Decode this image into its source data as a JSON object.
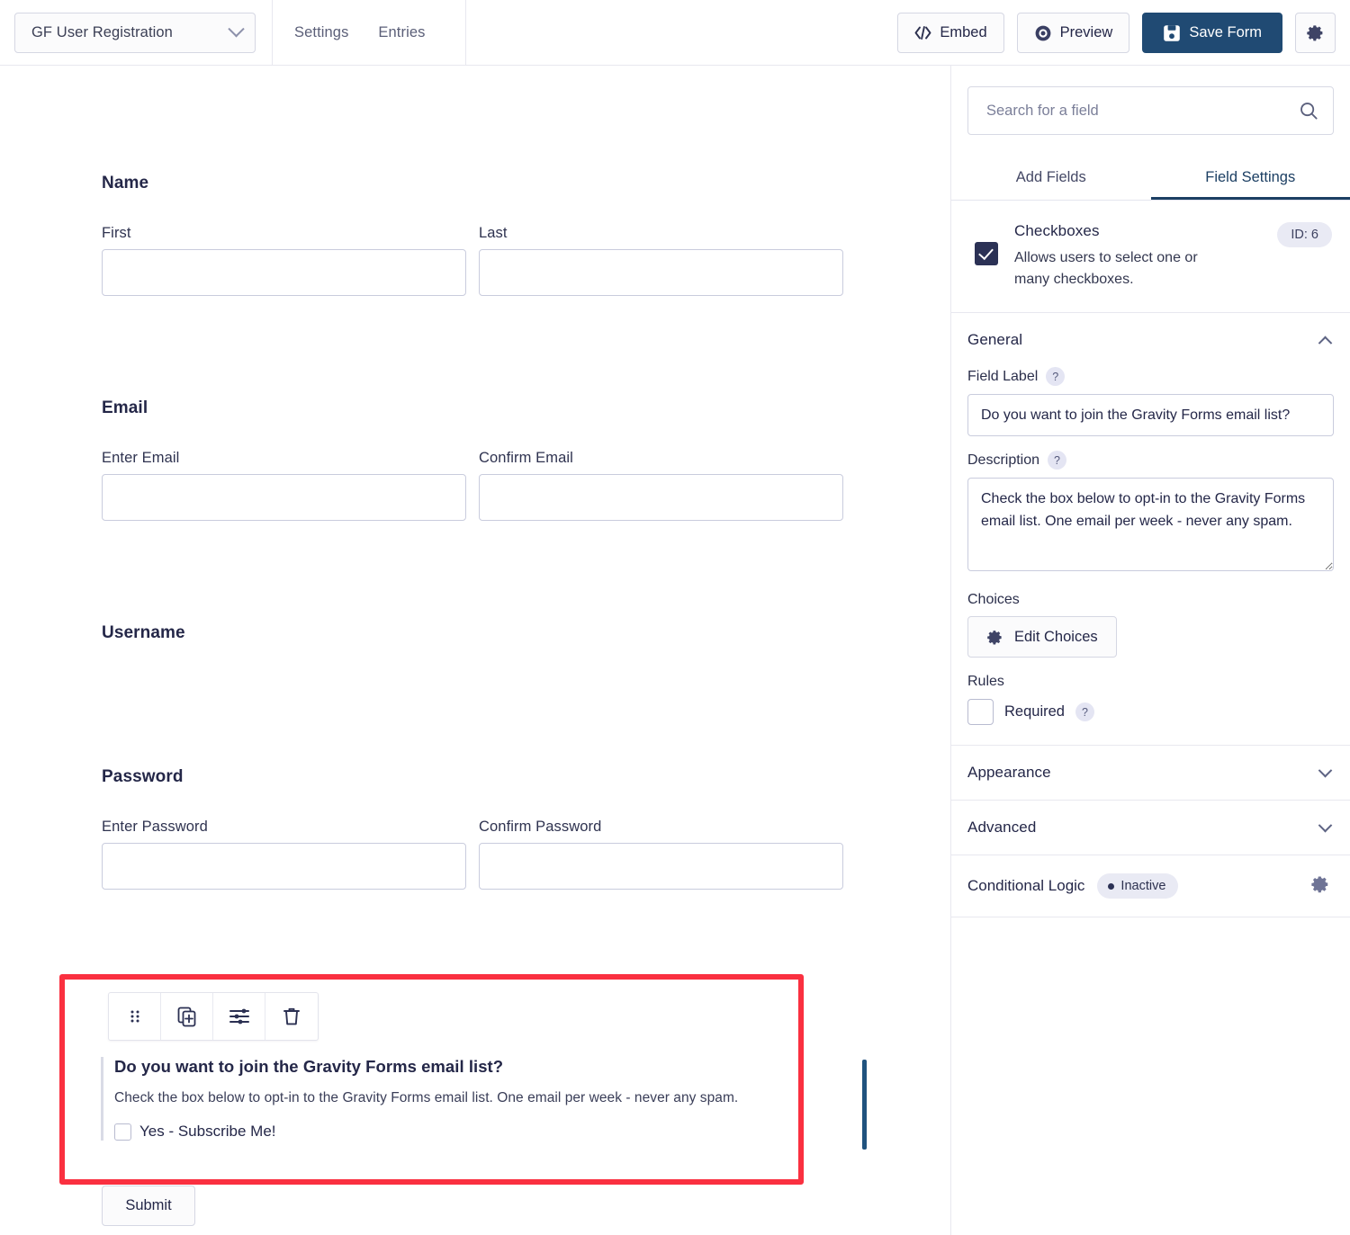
{
  "topbar": {
    "form_name": "GF User Registration",
    "nav_tabs": [
      {
        "label": "Settings"
      },
      {
        "label": "Entries"
      }
    ],
    "actions": {
      "embed_label": "Embed",
      "preview_label": "Preview",
      "save_label": "Save Form",
      "settings_icon": "gear-icon"
    }
  },
  "form": {
    "fields": [
      {
        "title": "Name",
        "inputs": [
          {
            "label": "First",
            "value": ""
          },
          {
            "label": "Last",
            "value": ""
          }
        ]
      },
      {
        "title": "Email",
        "inputs": [
          {
            "label": "Enter Email",
            "value": ""
          },
          {
            "label": "Confirm Email",
            "value": ""
          }
        ]
      },
      {
        "title": "Username",
        "inputs": []
      },
      {
        "title": "Password",
        "inputs": [
          {
            "label": "Enter Password",
            "value": ""
          },
          {
            "label": "Confirm Password",
            "value": ""
          }
        ]
      }
    ],
    "selected_field": {
      "label": "Do you want to join the Gravity Forms email list?",
      "description": "Check the box below to opt-in to the Gravity Forms email list. One email per week - never any spam.",
      "choices": [
        {
          "label": "Yes - Subscribe Me!",
          "checked": false
        }
      ],
      "toolbar_icons": [
        "drag-handle-icon",
        "duplicate-field-icon",
        "field-settings-icon",
        "delete-field-icon"
      ],
      "highlight_color": "#fa3040"
    },
    "submit_label": "Submit"
  },
  "sidebar": {
    "search": {
      "placeholder": "Search for a field",
      "value": "",
      "icon": "search-icon"
    },
    "tabs": [
      {
        "label": "Add Fields",
        "active": false
      },
      {
        "label": "Field Settings",
        "active": true
      }
    ],
    "field_header": {
      "title": "Checkboxes",
      "description": "Allows users to select one or many checkboxes.",
      "id_badge": "ID: 6",
      "checked": true
    },
    "general": {
      "title": "General",
      "field_label_caption": "Field Label",
      "field_label_value": "Do you want to join the Gravity Forms email list?",
      "description_caption": "Description",
      "description_value": "Check the box below to opt-in to the Gravity Forms email list. One email per week - never any spam.",
      "choices_caption": "Choices",
      "edit_choices_label": "Edit Choices",
      "rules_caption": "Rules",
      "required_label": "Required",
      "required_checked": false,
      "help_glyph": "?"
    },
    "appearance": {
      "title": "Appearance"
    },
    "advanced": {
      "title": "Advanced"
    },
    "conditional_logic": {
      "title": "Conditional Logic",
      "status": "Inactive",
      "gear_icon": "gear-icon"
    }
  },
  "colors": {
    "accent_blue": "#204a73",
    "highlight_red": "#fa3040",
    "marker_blue": "#20537f"
  }
}
